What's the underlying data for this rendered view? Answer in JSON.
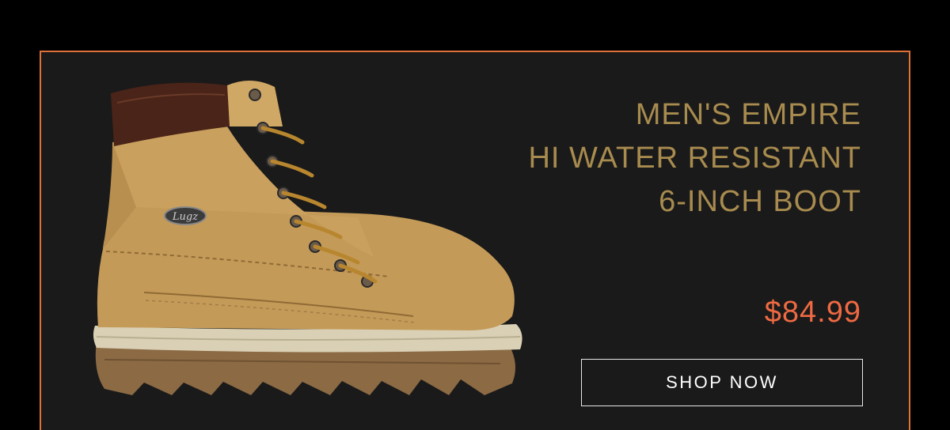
{
  "product": {
    "title_lines": [
      "MEN'S EMPIRE",
      "HI WATER RESISTANT",
      "6-INCH BOOT"
    ],
    "price": "$84.99",
    "cta_label": "SHOP NOW",
    "brand_logo_text": "Lugz",
    "image": "boot-image"
  },
  "colors": {
    "background": "#000000",
    "card": "#1a1a1a",
    "card_border": "#e0703a",
    "title": "#a88b4e",
    "price": "#ef6a42",
    "button_border": "#e8e8e8"
  }
}
